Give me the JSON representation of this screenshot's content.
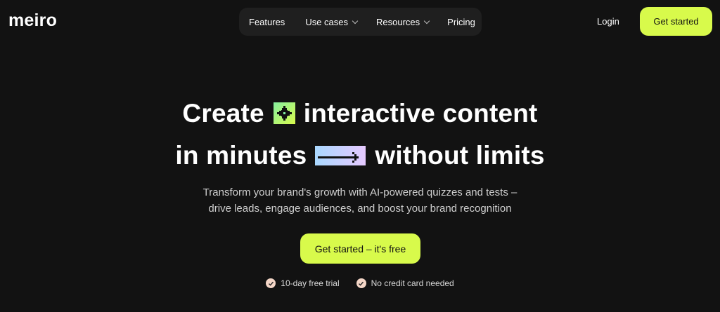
{
  "header": {
    "logo_text": "meiro",
    "nav": [
      {
        "label": "Features",
        "has_dropdown": false
      },
      {
        "label": "Use cases",
        "has_dropdown": true
      },
      {
        "label": "Resources",
        "has_dropdown": true
      },
      {
        "label": "Pricing",
        "has_dropdown": false
      }
    ],
    "login_label": "Login",
    "cta_label": "Get started"
  },
  "hero": {
    "line1_before": "Create",
    "line1_icon": "sparkle-icon",
    "line1_after": "interactive content",
    "line2_before": "in minutes",
    "line2_icon": "arrow-right-icon",
    "line2_after": "without limits",
    "subtitle_line1": "Transform your brand's growth with AI-powered quizzes and tests –",
    "subtitle_line2": "drive leads, engage audiences, and boost your brand recognition",
    "cta_label": "Get started – it's free",
    "perks": [
      {
        "icon": "check-icon",
        "label": "10-day free trial"
      },
      {
        "icon": "check-icon",
        "label": "No credit card needed"
      }
    ]
  },
  "colors": {
    "background": "#121212",
    "accent": "#d8fa4b",
    "nav_bg": "#1f1f1f"
  }
}
